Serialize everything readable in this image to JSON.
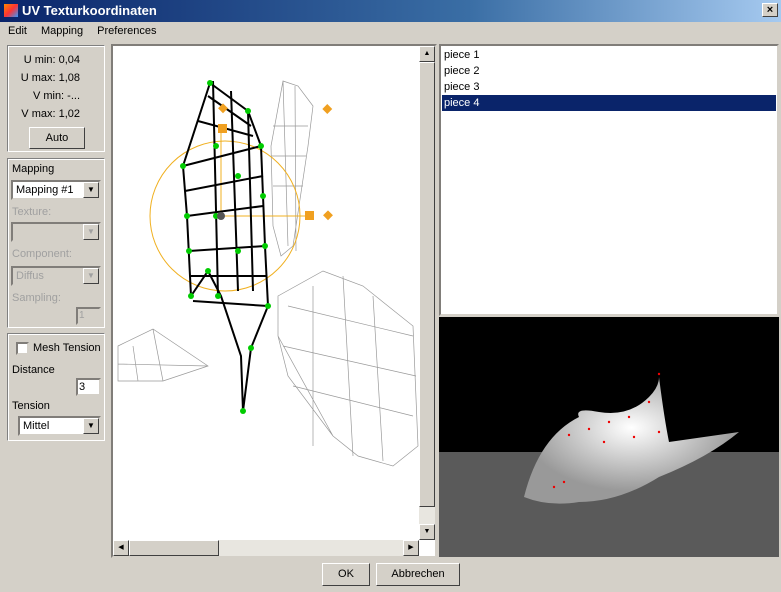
{
  "window": {
    "title": "UV Texturkoordinaten",
    "close": "×"
  },
  "menu": [
    "Edit",
    "Mapping",
    "Preferences"
  ],
  "uv_info": {
    "umin": "U min: 0,04",
    "umax": "U max: 1,08",
    "vmin": "V min: -...",
    "vmax": "V max: 1,02",
    "auto": "Auto"
  },
  "mapping": {
    "label": "Mapping",
    "value": "Mapping #1",
    "texture_label": "Texture:",
    "texture_value": "",
    "component_label": "Component:",
    "component_value": "Diffus",
    "sampling_label": "Sampling:",
    "sampling_value": "1"
  },
  "tension": {
    "mesh_tension": "Mesh Tension",
    "checked": false,
    "distance_label": "Distance",
    "distance_value": "3",
    "tension_label": "Tension",
    "tension_value": "Mittel"
  },
  "pieces": {
    "items": [
      "piece 1",
      "piece 2",
      "piece 3",
      "piece 4"
    ],
    "selected": 3
  },
  "buttons": {
    "ok": "OK",
    "cancel": "Abbrechen"
  },
  "colors": {
    "selection": "#0a246a",
    "vertex": "#00c000",
    "handle": "#f0a020"
  }
}
